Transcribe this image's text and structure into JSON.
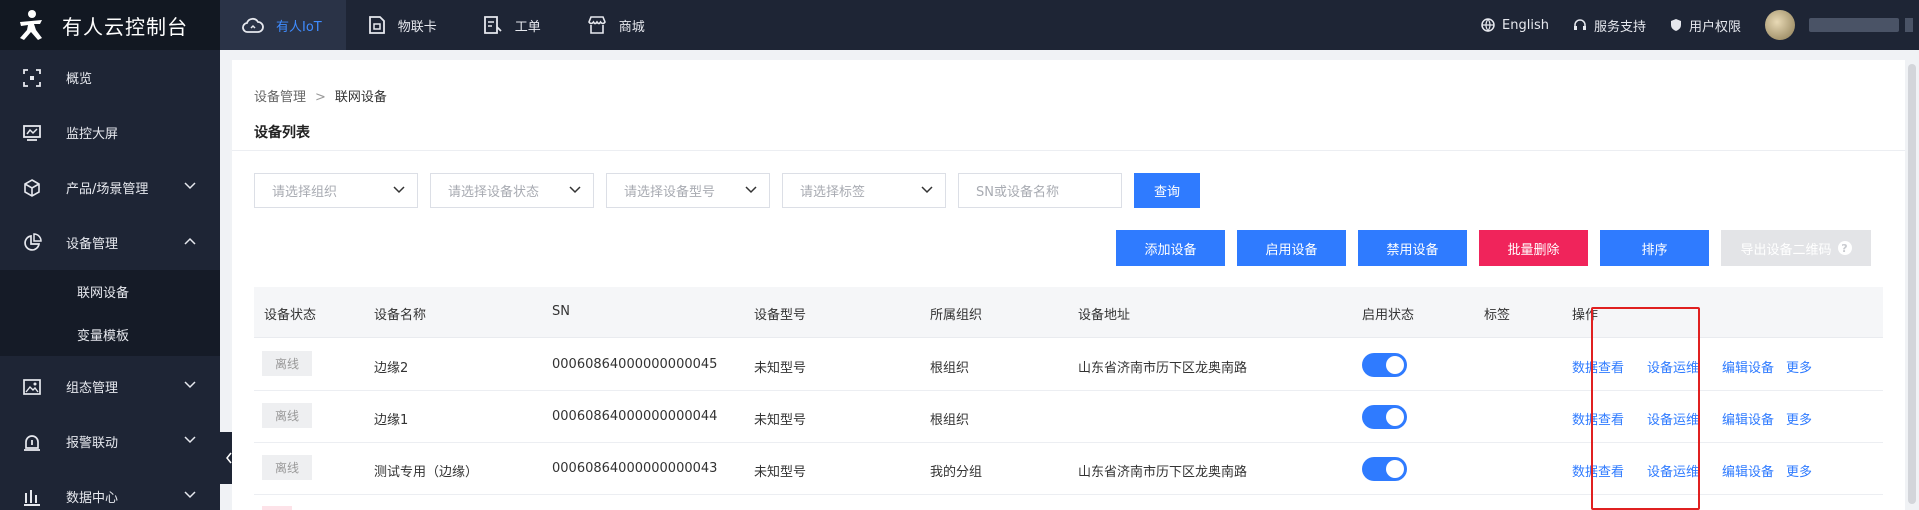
{
  "app": {
    "title": "有人云控制台"
  },
  "topnav": [
    {
      "label": "有人IoT",
      "icon": "cloud-icon",
      "active": true
    },
    {
      "label": "物联卡",
      "icon": "sim-card-icon",
      "active": false
    },
    {
      "label": "工单",
      "icon": "ticket-icon",
      "active": false
    },
    {
      "label": "商城",
      "icon": "shop-icon",
      "active": false
    }
  ],
  "topright": {
    "language": "English",
    "support": "服务支持",
    "permissions": "用户权限"
  },
  "sidebar": {
    "items": [
      {
        "label": "概览",
        "icon": "overview-icon"
      },
      {
        "label": "监控大屏",
        "icon": "monitor-icon"
      },
      {
        "label": "产品/场景管理",
        "icon": "cube-icon"
      },
      {
        "label": "设备管理",
        "icon": "pie-chart-icon",
        "expanded": true
      },
      {
        "label": "组态管理",
        "icon": "image-icon"
      },
      {
        "label": "报警联动",
        "icon": "alarm-icon"
      },
      {
        "label": "数据中心",
        "icon": "bar-chart-icon"
      }
    ],
    "subitems": [
      {
        "label": "联网设备",
        "active": true
      },
      {
        "label": "变量模板",
        "active": false
      }
    ]
  },
  "breadcrumb": {
    "parent": "设备管理",
    "current": "联网设备"
  },
  "page_title": "设备列表",
  "filters": {
    "org": "请选择组织",
    "status": "请选择设备状态",
    "model": "请选择设备型号",
    "tag": "请选择标签",
    "search_placeholder": "SN或设备名称",
    "query_label": "查询"
  },
  "actions": {
    "add": "添加设备",
    "enable": "启用设备",
    "disable": "禁用设备",
    "batch_delete": "批量删除",
    "sort": "排序",
    "export_qr": "导出设备二维码",
    "help_glyph": "?"
  },
  "table": {
    "headers": [
      "设备状态",
      "设备名称",
      "SN",
      "设备型号",
      "所属组织",
      "设备地址",
      "启用状态",
      "标签",
      "操作"
    ],
    "rows": [
      {
        "status": "离线",
        "name": "边缘2",
        "sn": "00060864000000000045",
        "model": "未知型号",
        "org": "根组织",
        "address": "山东省济南市历下区龙奥南路",
        "enabled": true,
        "tag": ""
      },
      {
        "status": "离线",
        "name": "边缘1",
        "sn": "00060864000000000044",
        "model": "未知型号",
        "org": "根组织",
        "address": "",
        "enabled": true,
        "tag": ""
      },
      {
        "status": "离线",
        "name": "测试专用（边缘）",
        "sn": "00060864000000000043",
        "model": "未知型号",
        "org": "我的分组",
        "address": "山东省济南市历下区龙奥南路",
        "enabled": true,
        "tag": ""
      }
    ],
    "row_actions": {
      "data_view": "数据查看",
      "ops": "设备运维",
      "edit": "编辑设备",
      "more": "更多"
    }
  },
  "colors": {
    "primary": "#2f7bff",
    "danger": "#f0245b",
    "topbar": "#1e2535",
    "highlight_box": "#e02020"
  }
}
